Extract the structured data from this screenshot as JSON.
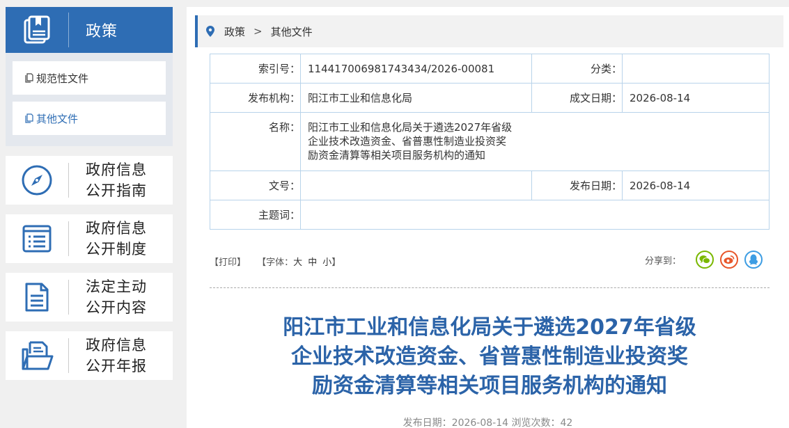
{
  "sidebar": {
    "policy": {
      "title": "政策"
    },
    "sub_items": [
      {
        "label": "规范性文件"
      },
      {
        "label": "其他文件"
      }
    ],
    "cards": [
      {
        "line1": "政府信息",
        "line2": "公开指南",
        "icon": "compass-icon"
      },
      {
        "line1": "政府信息",
        "line2": "公开制度",
        "icon": "list-document-icon"
      },
      {
        "line1": "法定主动",
        "line2": "公开内容",
        "icon": "document-icon"
      },
      {
        "line1": "政府信息",
        "line2": "公开年报",
        "icon": "open-folder-icon"
      }
    ]
  },
  "breadcrumb": {
    "root": "政策",
    "separator": ">",
    "current": "其他文件"
  },
  "meta": {
    "index_label": "索引号：",
    "index_value": "114417006981743434/2026-00081",
    "category_label": "分类：",
    "category_value": "",
    "issuer_label": "发布机构：",
    "issuer_value": "阳江市工业和信息化局",
    "written_date_label": "成文日期：",
    "written_date_value": "2026-08-14",
    "name_label": "名称：",
    "name_lines": [
      "阳江市工业和信息化局关于遴选2027年省级",
      "企业技术改造资金、省普惠性制造业投资奖",
      "励资金清算等相关项目服务机构的通知"
    ],
    "docno_label": "文号：",
    "docno_value": "",
    "pub_date_label": "发布日期：",
    "pub_date_value": "2026-08-14",
    "keywords_label": "主题词：",
    "keywords_value": ""
  },
  "tools": {
    "print": "【打印】",
    "font_prefix": "【字体：",
    "font_large": "大",
    "font_medium": "中",
    "font_small": "小",
    "font_suffix": "】",
    "share_label": "分享到："
  },
  "article": {
    "title_lines": [
      "阳江市工业和信息化局关于遴选2027年省级",
      "企业技术改造资金、省普惠性制造业投资奖",
      "励资金清算等相关项目服务机构的通知"
    ],
    "pub_meta": "发布日期：2026-08-14  浏览次数：42"
  },
  "colors": {
    "accent": "#2e6db4",
    "title": "#2b63a8",
    "wechat": "#7ab800",
    "weibo": "#e8562a",
    "qq": "#3d9de3"
  }
}
